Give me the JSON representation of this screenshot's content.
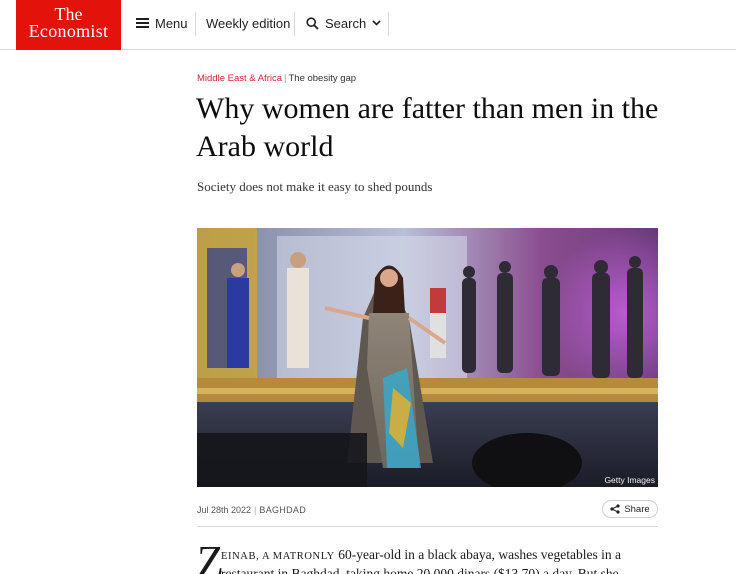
{
  "header": {
    "logo_line1": "The",
    "logo_line2": "Economist",
    "menu_label": "Menu",
    "weekly_label": "Weekly edition",
    "search_label": "Search"
  },
  "article": {
    "section": "Middle East & Africa",
    "topic": "The obesity gap",
    "headline": "Why women are fatter than men in the Arab world",
    "subheadline": "Society does not make it easy to shed pounds",
    "image_credit": "Getty Images",
    "date": "Jul 28th 2022",
    "dateline": "BAGHDAD",
    "share_label": "Share",
    "dropcap": "Z",
    "lead_smallcaps": "EINAB, A MATRONLY",
    "lead_rest": " 60-year-old in a black abaya, washes vegetables in a",
    "line2": "restaurant in Baghdad, taking home 20,000 dinars ($13.70) a day. But she"
  },
  "colors": {
    "brand_red": "#e3120b",
    "section_red": "#d5243b"
  }
}
